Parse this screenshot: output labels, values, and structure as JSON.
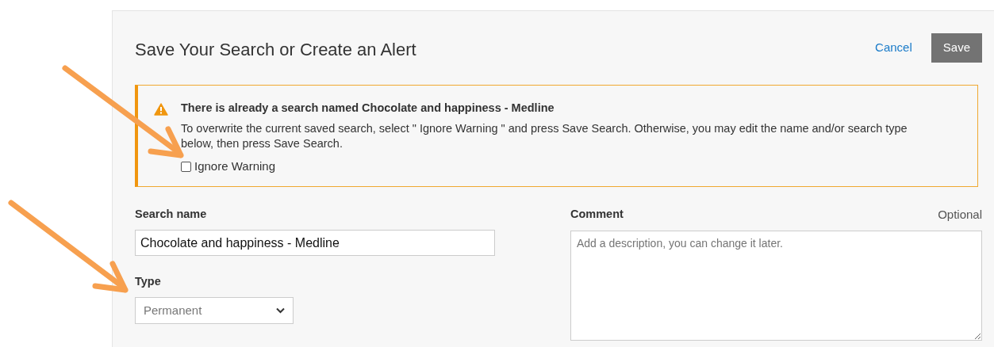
{
  "dialog": {
    "title": "Save Your Search or Create an Alert",
    "actions": [
      {
        "kind": "link",
        "label": "Cancel"
      },
      {
        "kind": "button",
        "label": "Save"
      }
    ]
  },
  "warning": {
    "heading": "There is already a search named Chocolate and happiness - Medline",
    "message": "To overwrite the current saved search, select \" Ignore Warning \" and press Save Search. Otherwise, you may edit the name and/or search type below, then press Save Search.",
    "checkbox": {
      "label": "Ignore Warning",
      "checked": false
    }
  },
  "search_name": {
    "label": "Search name",
    "value": "Chocolate and happiness - Medline"
  },
  "type": {
    "label": "Type",
    "value": "Permanent"
  },
  "comment": {
    "label": "Comment",
    "hint": "Optional",
    "placeholder": "Add a description, you can change it later."
  }
}
